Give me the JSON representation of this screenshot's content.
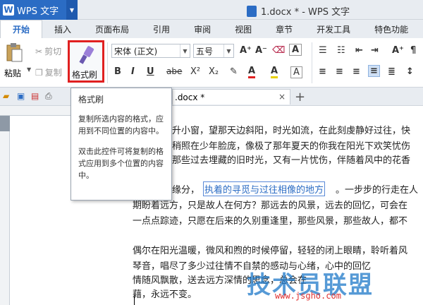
{
  "titlebar": {
    "app_name": "WPS 文字",
    "doc_title": "1.docx * - WPS 文字"
  },
  "tabs": [
    "开始",
    "插入",
    "页面布局",
    "引用",
    "审阅",
    "视图",
    "章节",
    "开发工具",
    "特色功能"
  ],
  "ribbon": {
    "paste_label": "粘贴",
    "cut_label": "剪切",
    "copy_label": "复制",
    "format_painter_label": "格式刷",
    "font_name": "宋体 (正文)",
    "font_size": "五号",
    "bold": "B",
    "italic": "I",
    "underline": "U",
    "strike": "abe",
    "superscript": "X²",
    "subscript": "X₂",
    "font_color": "A",
    "highlight": "A",
    "grow": "A⁺",
    "shrink": "A⁻"
  },
  "tooltip": {
    "title": "格式刷",
    "desc1": "复制所选内容的格式，应用到不同位置的内容中。",
    "desc2": "双击此控件可将复制的格式应用到多个位置的内容中。"
  },
  "doc_tab": {
    "name": ".docx *",
    "close": "×",
    "new_tab": "+"
  },
  "document": {
    "lines": [
      "升小窗，望那天边斜阳，时光如流，在此刻虔静好过往，快",
      "稍照在少年脸庞，像极了那年夏天的你我在阳光下欢笑忧伤",
      "那些过去埋藏的旧时光，又有一片忧伤，伴随着风中的花香",
      "缘分，",
      "执着的寻觅与过往相像的地方",
      "。一步步的行走在人",
      "期盼着远方，只是故人在何方？那远去的风景，远去的回忆，可会在",
      "一点点踪迹，只愿在后来的久别重逢里，那些风景，那些故人，都不",
      "偶尔在阳光温暖，微风和煦的时候停留，轻轻的闭上眼睛，聆听着风",
      "琴音，唱尽了多少过往情不自禁的感动与心绪，心中的回忆",
      "情随风飘散，送去远方深情的思念，总会在",
      "藉，永远不变。"
    ]
  },
  "watermark": {
    "brand": "技术员联盟",
    "url": "www.jsgho.com"
  },
  "colors": {
    "accent": "#2b6cc4",
    "highlight_box": "#e02020"
  }
}
